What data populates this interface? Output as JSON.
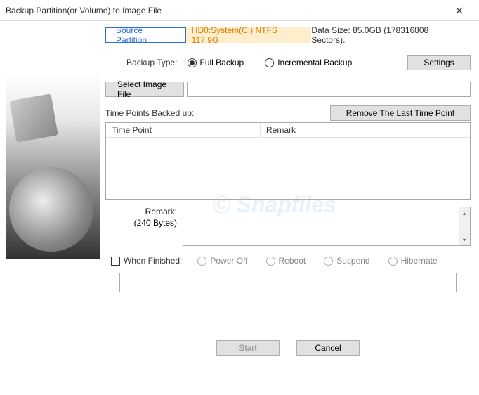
{
  "titlebar": {
    "title": "Backup Partition(or Volume) to Image File"
  },
  "tabs": {
    "source": "Source Partition",
    "info": "HD0:System(C:) NTFS 117.9G"
  },
  "data_size": "Data Size: 85.0GB (178316808 Sectors).",
  "backup_type": {
    "label": "Backup Type:",
    "full": "Full Backup",
    "incremental": "Incremental Backup"
  },
  "settings_btn": "Settings",
  "select_image_btn": "Select Image File",
  "image_path": "",
  "timepoints_label": "Time Points Backed up:",
  "remove_btn": "Remove The Last Time Point",
  "table": {
    "col1": "Time Point",
    "col2": "Remark"
  },
  "remark": {
    "label1": "Remark:",
    "label2": "(240 Bytes)"
  },
  "finish": {
    "label": "When Finished:",
    "poweroff": "Power Off",
    "reboot": "Reboot",
    "suspend": "Suspend",
    "hibernate": "Hibernate"
  },
  "footer": {
    "start": "Start",
    "cancel": "Cancel"
  },
  "watermark": "Snapfiles"
}
